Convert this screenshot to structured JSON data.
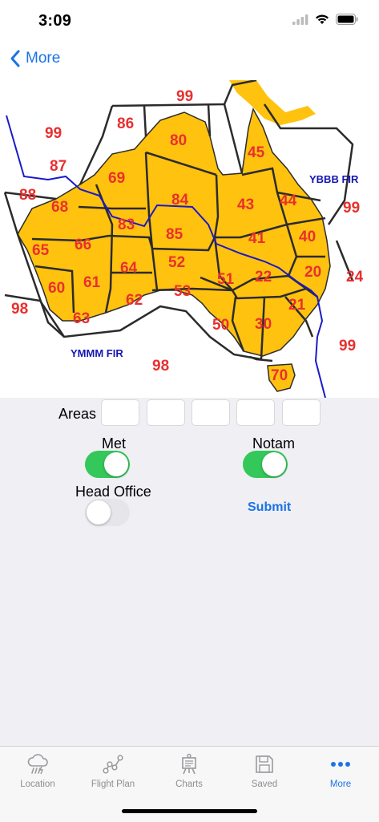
{
  "status_bar": {
    "time": "3:09"
  },
  "nav": {
    "back_label": "More"
  },
  "map": {
    "area_labels": [
      "99",
      "86",
      "99",
      "80",
      "87",
      "69",
      "88",
      "68",
      "45",
      "84",
      "43",
      "44",
      "99",
      "66",
      "83",
      "85",
      "41",
      "40",
      "65",
      "64",
      "52",
      "20",
      "24",
      "60",
      "61",
      "51",
      "22",
      "53",
      "62",
      "21",
      "98",
      "63",
      "50",
      "30",
      "99",
      "98",
      "70"
    ],
    "fir_labels": [
      "YBBB FIR",
      "YMMM FIR"
    ],
    "colors": {
      "land": "#ffc20e",
      "boundary": "#2b2b2b",
      "fir_line": "#1a1ac8",
      "label": "#e8302f"
    }
  },
  "form": {
    "areas_label": "Areas",
    "area_values": [
      "",
      "",
      "",
      "",
      ""
    ],
    "met_label": "Met",
    "met_on": true,
    "notam_label": "Notam",
    "notam_on": true,
    "head_office_label": "Head Office",
    "head_office_on": false,
    "submit_label": "Submit"
  },
  "tabs": [
    {
      "label": "Location",
      "icon": "cloud-rain-icon",
      "active": false
    },
    {
      "label": "Flight Plan",
      "icon": "route-icon",
      "active": false
    },
    {
      "label": "Charts",
      "icon": "easel-icon",
      "active": false
    },
    {
      "label": "Saved",
      "icon": "floppy-disk-icon",
      "active": false
    },
    {
      "label": "More",
      "icon": "ellipsis-icon",
      "active": true
    }
  ]
}
